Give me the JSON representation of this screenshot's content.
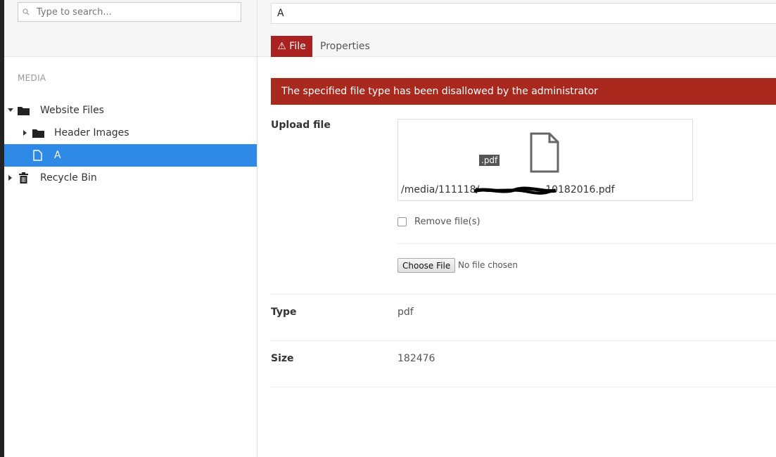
{
  "search": {
    "placeholder": "Type to search..."
  },
  "sidebar": {
    "section_title": "MEDIA",
    "items": [
      {
        "label": "Website Files",
        "icon": "folder-icon"
      },
      {
        "label": "Header Images",
        "icon": "folder-icon"
      },
      {
        "label": "A",
        "icon": "file-icon"
      },
      {
        "label": "Recycle Bin",
        "icon": "trash-icon"
      }
    ]
  },
  "main": {
    "name_value": "A",
    "tabs": [
      {
        "label": "⚠ File"
      },
      {
        "label": "Properties"
      }
    ],
    "alert_text": "The specified file type has been disallowed by the administrator",
    "upload": {
      "label": "Upload file",
      "ext_badge": ".pdf",
      "path_prefix": "/media/111118/",
      "path_suffix": "10182016.pdf",
      "remove_label": "Remove file(s)",
      "choose_button": "Choose File",
      "no_file_text": "No file chosen"
    },
    "type": {
      "label": "Type",
      "value": "pdf"
    },
    "size": {
      "label": "Size",
      "value": "182476"
    }
  },
  "colors": {
    "selected": "#2e8ae6",
    "alert": "#a9291f",
    "tab_active": "#a9221f"
  }
}
